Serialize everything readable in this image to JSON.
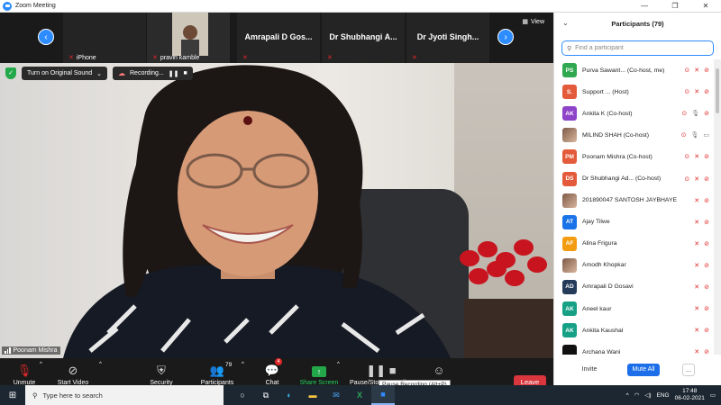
{
  "window": {
    "title": "Zoom Meeting"
  },
  "thumbnails": [
    {
      "name": "iPhone",
      "muted": true
    },
    {
      "name": "pravin kamble",
      "muted": true
    },
    {
      "name": "Amrapali D Gos...",
      "muted": true
    },
    {
      "name": "Dr Shubhangi A...",
      "muted": true
    },
    {
      "name": "Dr Jyoti  Singh...",
      "muted": true
    }
  ],
  "view_label": "View",
  "video": {
    "sound_label": "Turn on Original Sound",
    "recording_label": "Recording...",
    "speaker": "Poonam Mishra"
  },
  "toolbar": {
    "unmute": "Unmute",
    "start_video": "Start Video",
    "security": "Security",
    "participants": "Participants",
    "participants_count": "79",
    "chat": "Chat",
    "chat_badge": "4",
    "share_screen": "Share Screen",
    "pause_stop": "Pause/Stop Recording",
    "tooltip": "Pause Recording (Alt+P)",
    "leave": "Leave"
  },
  "panel": {
    "title": "Participants (79)",
    "search_placeholder": "Find a participant",
    "participants": [
      {
        "initials": "PS",
        "name": "Purva Sawant... (Co-host, me)",
        "color": "#2fa84f",
        "photo": false,
        "video": "off"
      },
      {
        "initials": "S.",
        "name": "Support ... (Host)",
        "color": "#e35b3b",
        "photo": false,
        "video": "off"
      },
      {
        "initials": "AK",
        "name": "Ankita K (Co-host)",
        "color": "#8e44c8",
        "photo": false,
        "video": "off"
      },
      {
        "initials": "",
        "name": "MILIND SHAH (Co-host)",
        "color": "#555555",
        "photo": true,
        "video": "on"
      },
      {
        "initials": "PM",
        "name": "Poonam Mishra (Co-host)",
        "color": "#e35b3b",
        "photo": false,
        "video": "off"
      },
      {
        "initials": "DS",
        "name": "Dr Shubhangi Ad...  (Co-host)",
        "color": "#e35b3b",
        "photo": false,
        "video": "off"
      },
      {
        "initials": "",
        "name": "201890047 SANTOSH JAYBHAYE",
        "color": "#555555",
        "photo": true,
        "video": "off"
      },
      {
        "initials": "AT",
        "name": "Ajay Tilwe",
        "color": "#1a73e8",
        "photo": false,
        "video": "off"
      },
      {
        "initials": "AF",
        "name": "Alina Frigura",
        "color": "#f39c12",
        "photo": false,
        "video": "off"
      },
      {
        "initials": "",
        "name": "Amodh Khopkar",
        "color": "#555555",
        "photo": true,
        "video": "off"
      },
      {
        "initials": "AD",
        "name": "Amrapali D Gosavi",
        "color": "#253b5a",
        "photo": false,
        "video": "off"
      },
      {
        "initials": "AK",
        "name": "Aneel kaur",
        "color": "#16a085",
        "photo": false,
        "video": "off"
      },
      {
        "initials": "AK",
        "name": "Ankita Kaushal",
        "color": "#16a085",
        "photo": false,
        "video": "off"
      },
      {
        "initials": "",
        "name": "Archana Wani",
        "color": "#111111",
        "photo": false,
        "video": "off"
      }
    ],
    "invite": "Invite",
    "mute_all": "Mute All",
    "more": "..."
  },
  "taskbar": {
    "search_placeholder": "Type here to search",
    "lang": "ENG",
    "time": "17:48",
    "date": "06-02-2021"
  },
  "colors": {
    "accent": "#2d8cff",
    "leave": "#d9363e",
    "muted": "#e02828"
  }
}
